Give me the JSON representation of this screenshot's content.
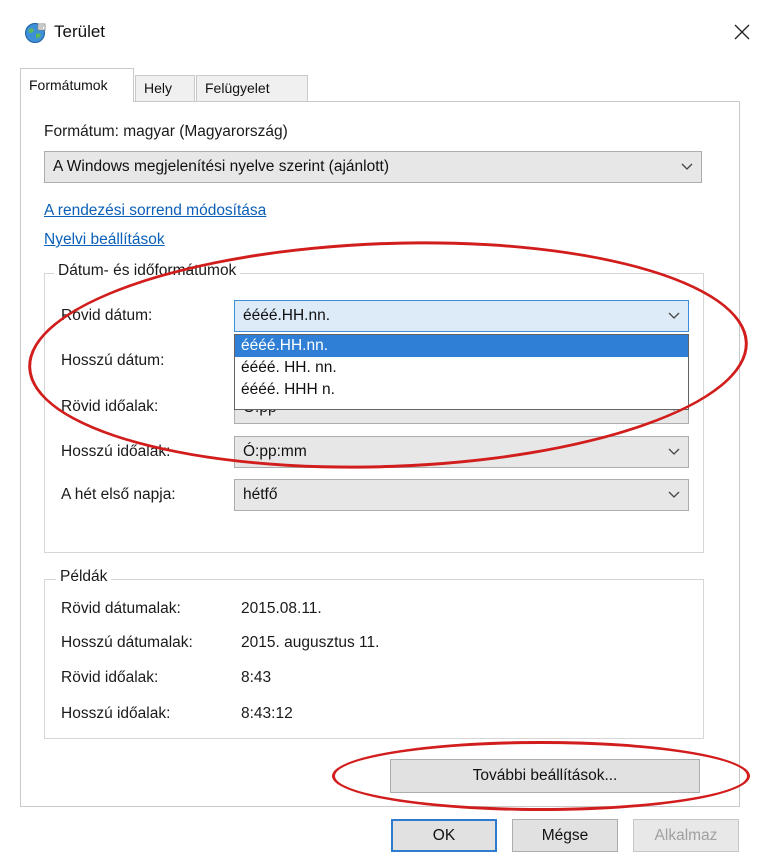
{
  "window": {
    "title": "Terület",
    "close_glyph": "✕"
  },
  "tabs": [
    {
      "label": "Formátumok",
      "active": true
    },
    {
      "label": "Hely",
      "active": false
    },
    {
      "label": "Felügyelet",
      "active": false
    }
  ],
  "format": {
    "label": "Formátum: magyar (Magyarország)",
    "select_value": "A Windows megjelenítési nyelve szerint (ajánlott)",
    "link_sort": "A rendezési sorrend módosítása",
    "link_language": "Nyelvi beállítások"
  },
  "datetime_group": {
    "title": "Dátum- és időformátumok",
    "rows": [
      {
        "label": "Rövid dátum:",
        "value": "éééé.HH.nn."
      },
      {
        "label": "Hosszú dátum:",
        "value": ""
      },
      {
        "label": "Rövid időalak:",
        "value": "Ó:pp"
      },
      {
        "label": "Hosszú időalak:",
        "value": "Ó:pp:mm"
      },
      {
        "label": "A hét első napja:",
        "value": "hétfő"
      }
    ],
    "dropdown_options": [
      "éééé.HH.nn.",
      "éééé. HH. nn.",
      "éééé. HHH n."
    ],
    "dropdown_selected_index": 0
  },
  "examples": {
    "title": "Példák",
    "rows": [
      {
        "label": "Rövid dátumalak:",
        "value": "2015.08.11."
      },
      {
        "label": "Hosszú dátumalak:",
        "value": "2015. augusztus 11."
      },
      {
        "label": "Rövid időalak:",
        "value": "8:43"
      },
      {
        "label": "Hosszú időalak:",
        "value": "8:43:12"
      }
    ]
  },
  "buttons": {
    "additional": "További beállítások...",
    "ok": "OK",
    "cancel": "Mégse",
    "apply": "Alkalmaz"
  },
  "colors": {
    "link": "#0a5fb8",
    "selection": "#2f7fd6",
    "annotation": "#d21d1d"
  }
}
